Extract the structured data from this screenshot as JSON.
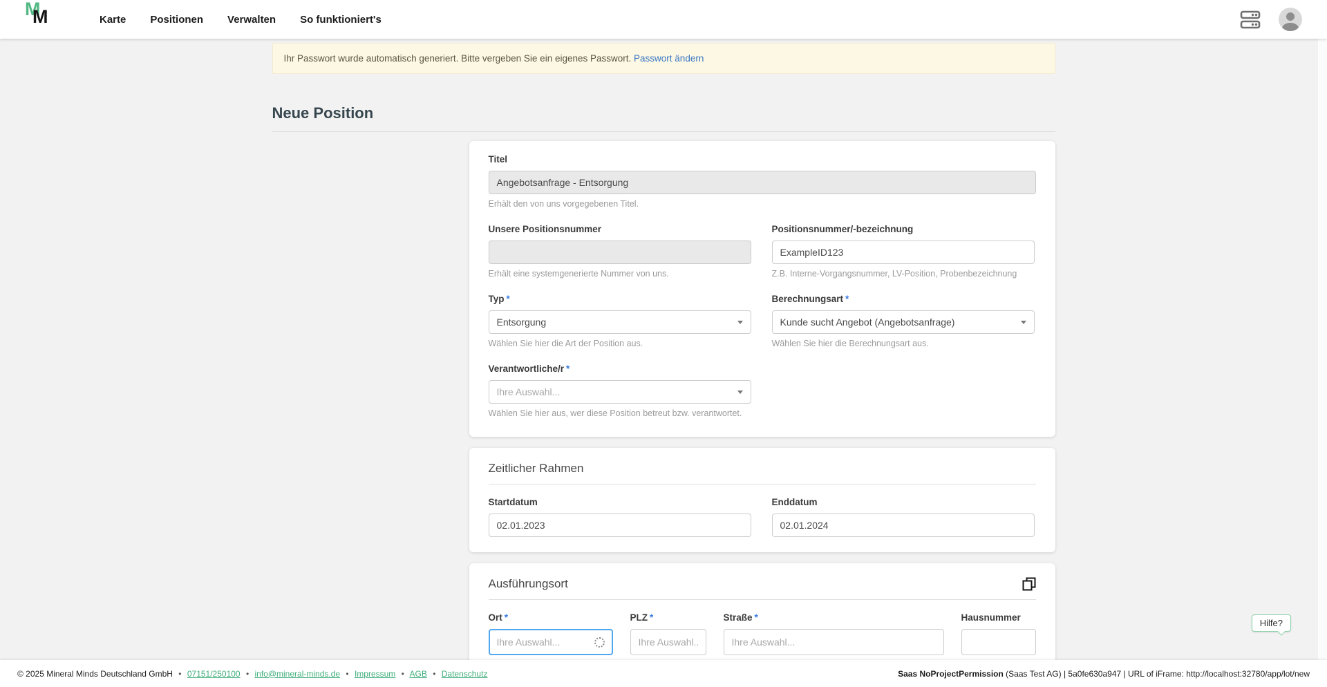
{
  "nav": {
    "items": [
      {
        "label": "Karte"
      },
      {
        "label": "Positionen"
      },
      {
        "label": "Verwalten"
      },
      {
        "label": "So funktioniert's"
      }
    ]
  },
  "banner": {
    "text": "Ihr Passwort wurde automatisch generiert. Bitte vergeben Sie ein eigenes Passwort.",
    "link": "Passwort ändern"
  },
  "page": {
    "title": "Neue Position"
  },
  "form": {
    "titel": {
      "label": "Titel",
      "value": "Angebotsanfrage - Entsorgung",
      "helper": "Erhält den von uns vorgegebenen Titel."
    },
    "unsere_positionsnummer": {
      "label": "Unsere Positionsnummer",
      "value": "",
      "helper": "Erhält eine systemgenerierte Nummer von uns."
    },
    "positionsnummer": {
      "label": "Positionsnummer/-bezeichnung",
      "value": "ExampleID123",
      "helper": "Z.B. Interne-Vorgangsnummer, LV-Position, Probenbezeichnung"
    },
    "typ": {
      "label": "Typ",
      "required": "*",
      "value": "Entsorgung",
      "helper": "Wählen Sie hier die Art der Position aus."
    },
    "berechnungsart": {
      "label": "Berechnungsart",
      "required": "*",
      "value": "Kunde sucht Angebot (Angebotsanfrage)",
      "helper": "Wählen Sie hier die Berechnungsart aus."
    },
    "verantwortliche": {
      "label": "Verantwortliche/r",
      "required": "*",
      "placeholder": "Ihre Auswahl...",
      "helper": "Wählen Sie hier aus, wer diese Position betreut bzw. verantwortet."
    }
  },
  "zeitraum": {
    "heading": "Zeitlicher Rahmen",
    "startdatum": {
      "label": "Startdatum",
      "value": "02.01.2023"
    },
    "enddatum": {
      "label": "Enddatum",
      "value": "02.01.2024"
    }
  },
  "ausfuehrungsort": {
    "heading": "Ausführungsort",
    "ort": {
      "label": "Ort",
      "required": "*",
      "placeholder": "Ihre Auswahl..."
    },
    "plz": {
      "label": "PLZ",
      "required": "*",
      "placeholder": "Ihre Auswahl.."
    },
    "strasse": {
      "label": "Straße",
      "required": "*",
      "placeholder": "Ihre Auswahl..."
    },
    "hausnummer": {
      "label": "Hausnummer"
    }
  },
  "footer": {
    "copyright": "© 2025 Mineral Minds Deutschland GmbH",
    "sep": "•",
    "links": [
      {
        "label": "07151/250100"
      },
      {
        "label": "info@mineral-minds.de"
      },
      {
        "label": "Impressum"
      },
      {
        "label": "AGB"
      },
      {
        "label": "Datenschutz"
      }
    ],
    "right_bold": "Saas NoProjectPermission",
    "right_rest": " (Saas Test AG) | 5a0fe630a947 | URL of iFrame: http://localhost:32780/app/lot/new"
  },
  "help": {
    "label": "Hilfe?"
  },
  "colors": {
    "brand_green": "#52b884",
    "link_blue": "#3b77c4",
    "required_blue": "#3779e3",
    "focus_blue": "#51a7f0",
    "banner_bg": "#fdf8e4",
    "page_bg": "#f2f2f2"
  }
}
